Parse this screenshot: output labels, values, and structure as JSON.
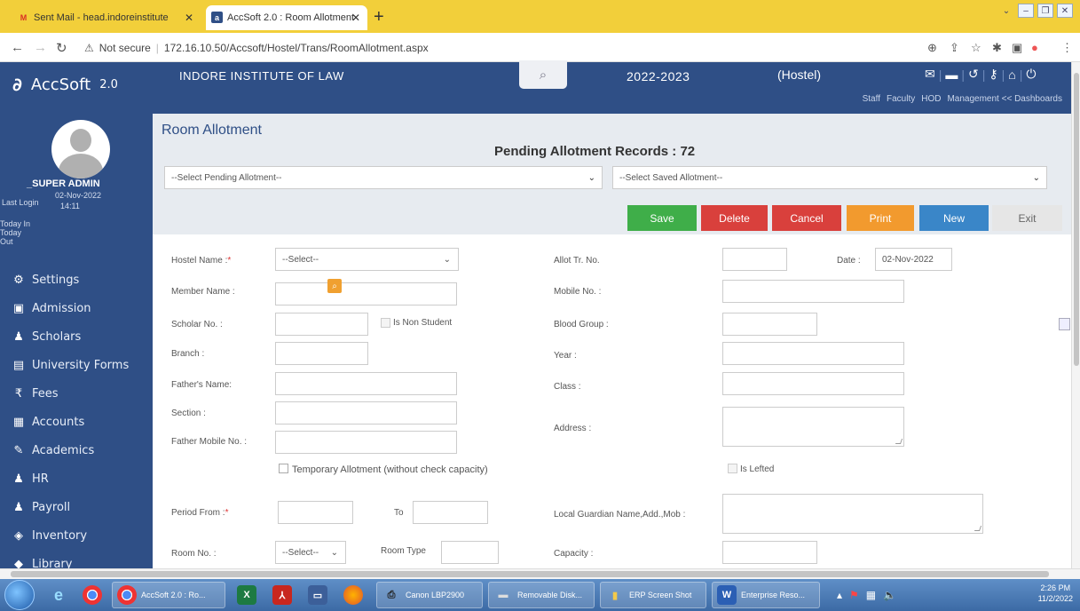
{
  "browser": {
    "tabs": [
      {
        "title": "Sent Mail - head.indoreinstitute",
        "favicon": "gmail-icon"
      },
      {
        "title": "AccSoft 2.0 : Room Allotment",
        "favicon": "accsoft-icon"
      }
    ],
    "security_label": "Not secure",
    "url": "172.16.10.50/Accsoft/Hostel/Trans/RoomAllotment.aspx"
  },
  "header": {
    "app_name": "AccSoft",
    "app_version": "2.0",
    "institute": "INDORE INSTITUTE OF LAW",
    "session": "2022-2023",
    "module": "(Hostel)",
    "links": [
      "Staff",
      "Faculty",
      "HOD",
      "Management << Dashboards"
    ]
  },
  "sidebar": {
    "user": "_SUPER ADMIN",
    "last_login_label": "Last Login",
    "last_login_date": "02-Nov-2022",
    "last_login_time": "14:11",
    "today_in": "Today In",
    "today_out": "Today Out",
    "menu": [
      {
        "label": "Settings",
        "icon": "gears-icon"
      },
      {
        "label": "Admission",
        "icon": "id-card-icon"
      },
      {
        "label": "Scholars",
        "icon": "user-icon"
      },
      {
        "label": "University Forms",
        "icon": "document-icon"
      },
      {
        "label": "Fees",
        "icon": "rupee-icon"
      },
      {
        "label": "Accounts",
        "icon": "ledger-icon"
      },
      {
        "label": "Academics",
        "icon": "pencil-icon"
      },
      {
        "label": "HR",
        "icon": "users-icon"
      },
      {
        "label": "Payroll",
        "icon": "users-icon"
      },
      {
        "label": "Inventory",
        "icon": "box-icon"
      },
      {
        "label": "Library",
        "icon": "book-icon"
      }
    ]
  },
  "page": {
    "title": "Room Allotment",
    "pending_label": "Pending Allotment Records : 72",
    "pending_select": "--Select Pending Allotment--",
    "saved_select": "--Select Saved Allotment--"
  },
  "buttons": {
    "save": "Save",
    "delete": "Delete",
    "cancel": "Cancel",
    "print": "Print",
    "new": "New",
    "exit": "Exit"
  },
  "colors": {
    "save": "#3fae49",
    "delete": "#d9403c",
    "cancel": "#d9403c",
    "print": "#f29a2e",
    "new": "#3a86c8",
    "exit": "#e6e6e6",
    "brand": "#2f4f86"
  },
  "form": {
    "hostel_name": "Hostel Name :",
    "hostel_select": "--Select--",
    "allot_tr_no": "Allot Tr. No.",
    "date_label": "Date :",
    "date_value": "02-Nov-2022",
    "member_name": "Member Name :",
    "mobile_no": "Mobile No. :",
    "scholar_no": "Scholar No. :",
    "is_non_student": "Is Non Student",
    "blood_group": "Blood Group :",
    "branch": "Branch :",
    "year": "Year :",
    "fathers_name": "Father's Name:",
    "class": "Class :",
    "section": "Section :",
    "address": "Address :",
    "father_mobile": "Father Mobile No. :",
    "temp_allotment": "Temporary Allotment (without check capacity)",
    "is_lefted": "Is Lefted",
    "period_from": "Period From :",
    "to": "To",
    "local_guardian": "Local Guardian Name,Add.,Mob :",
    "room_no": "Room No. :",
    "room_select": "--Select--",
    "room_type": "Room Type",
    "capacity": "Capacity :"
  },
  "taskbar": {
    "items": [
      "AccSoft 2.0 : Ro...",
      "Canon LBP2900",
      "Removable Disk...",
      "ERP Screen Shot",
      "Enterprise Reso..."
    ],
    "time": "2:26 PM",
    "date": "11/2/2022"
  }
}
